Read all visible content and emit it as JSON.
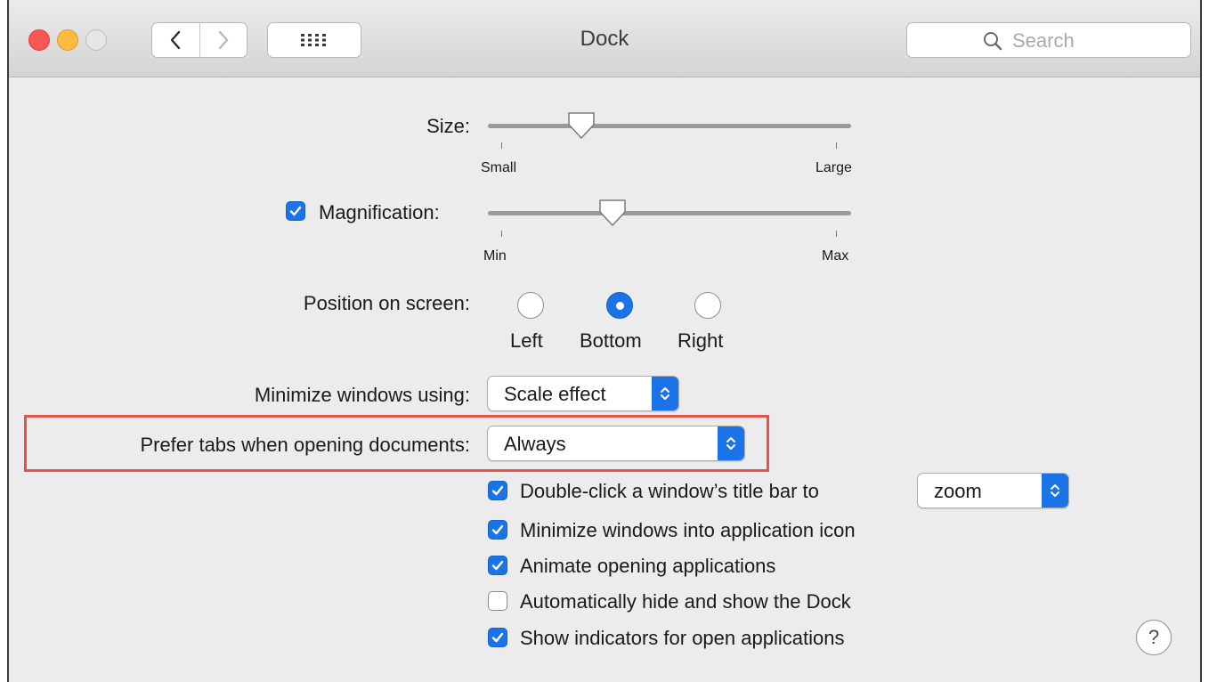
{
  "window": {
    "title": "Dock",
    "search_placeholder": "Search"
  },
  "size": {
    "label": "Size:",
    "min_label": "Small",
    "max_label": "Large",
    "value_fraction": 0.25
  },
  "magnification": {
    "label": "Magnification:",
    "checked": true,
    "min_label": "Min",
    "max_label": "Max",
    "value_fraction": 0.34
  },
  "position": {
    "label": "Position on screen:",
    "options": [
      "Left",
      "Bottom",
      "Right"
    ],
    "selected": "Bottom"
  },
  "minimize_using": {
    "label": "Minimize windows using:",
    "value": "Scale effect"
  },
  "prefer_tabs": {
    "label": "Prefer tabs when opening documents:",
    "value": "Always"
  },
  "double_click": {
    "label": "Double-click a window’s title bar to",
    "checked": true,
    "value": "zoom"
  },
  "checkboxes": [
    {
      "label": "Minimize windows into application icon",
      "checked": true
    },
    {
      "label": "Animate opening applications",
      "checked": true
    },
    {
      "label": "Automatically hide and show the Dock",
      "checked": false
    },
    {
      "label": "Show indicators for open applications",
      "checked": true
    }
  ],
  "help_label": "?",
  "colors": {
    "accent": "#1a74e8",
    "highlight_border": "#e9524a",
    "close": "#fc5753",
    "minimize": "#fdbc40"
  }
}
